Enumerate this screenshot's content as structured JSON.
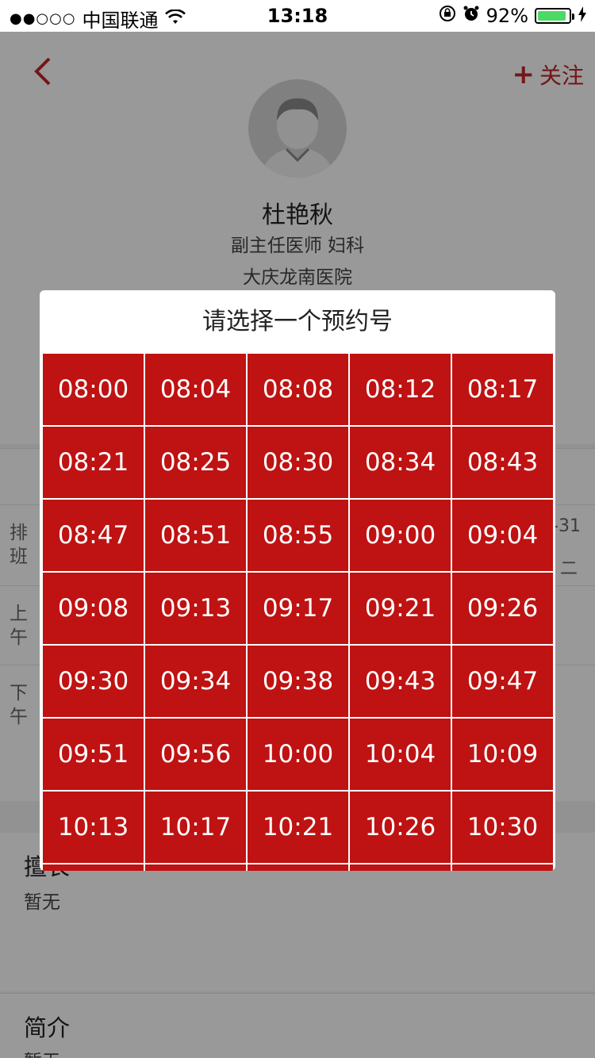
{
  "status_bar": {
    "signal": "●●○○○",
    "carrier": "中国联通",
    "time": "13:18",
    "battery": "92%",
    "battery_level": 0.92,
    "battery_color": "#4cd964"
  },
  "header": {
    "follow_plus": "+",
    "follow_label": "关注",
    "doctor_name": "杜艳秋",
    "doctor_title": "副主任医师 妇科",
    "hospital": "大庆龙南医院"
  },
  "schedule": {
    "row_label_1": "排班",
    "row_label_2": "上午",
    "row_label_3": "下午",
    "date_fragment": "-31",
    "weekday_fragment": "二"
  },
  "sections": {
    "specialty_title": "擅长",
    "specialty_body": "暂无",
    "intro_title": "简介",
    "intro_body": "暂无"
  },
  "modal": {
    "title": "请选择一个预约号",
    "slots": [
      "08:00",
      "08:04",
      "08:08",
      "08:12",
      "08:17",
      "08:21",
      "08:25",
      "08:30",
      "08:34",
      "08:43",
      "08:47",
      "08:51",
      "08:55",
      "09:00",
      "09:04",
      "09:08",
      "09:13",
      "09:17",
      "09:21",
      "09:26",
      "09:30",
      "09:34",
      "09:38",
      "09:43",
      "09:47",
      "09:51",
      "09:56",
      "10:00",
      "10:04",
      "10:09",
      "10:13",
      "10:17",
      "10:21",
      "10:26",
      "10:30"
    ]
  },
  "colors": {
    "accent": "#c0262b",
    "slot_bg": "#bf1212",
    "overlay": "rgba(0,0,0,0.4)"
  }
}
